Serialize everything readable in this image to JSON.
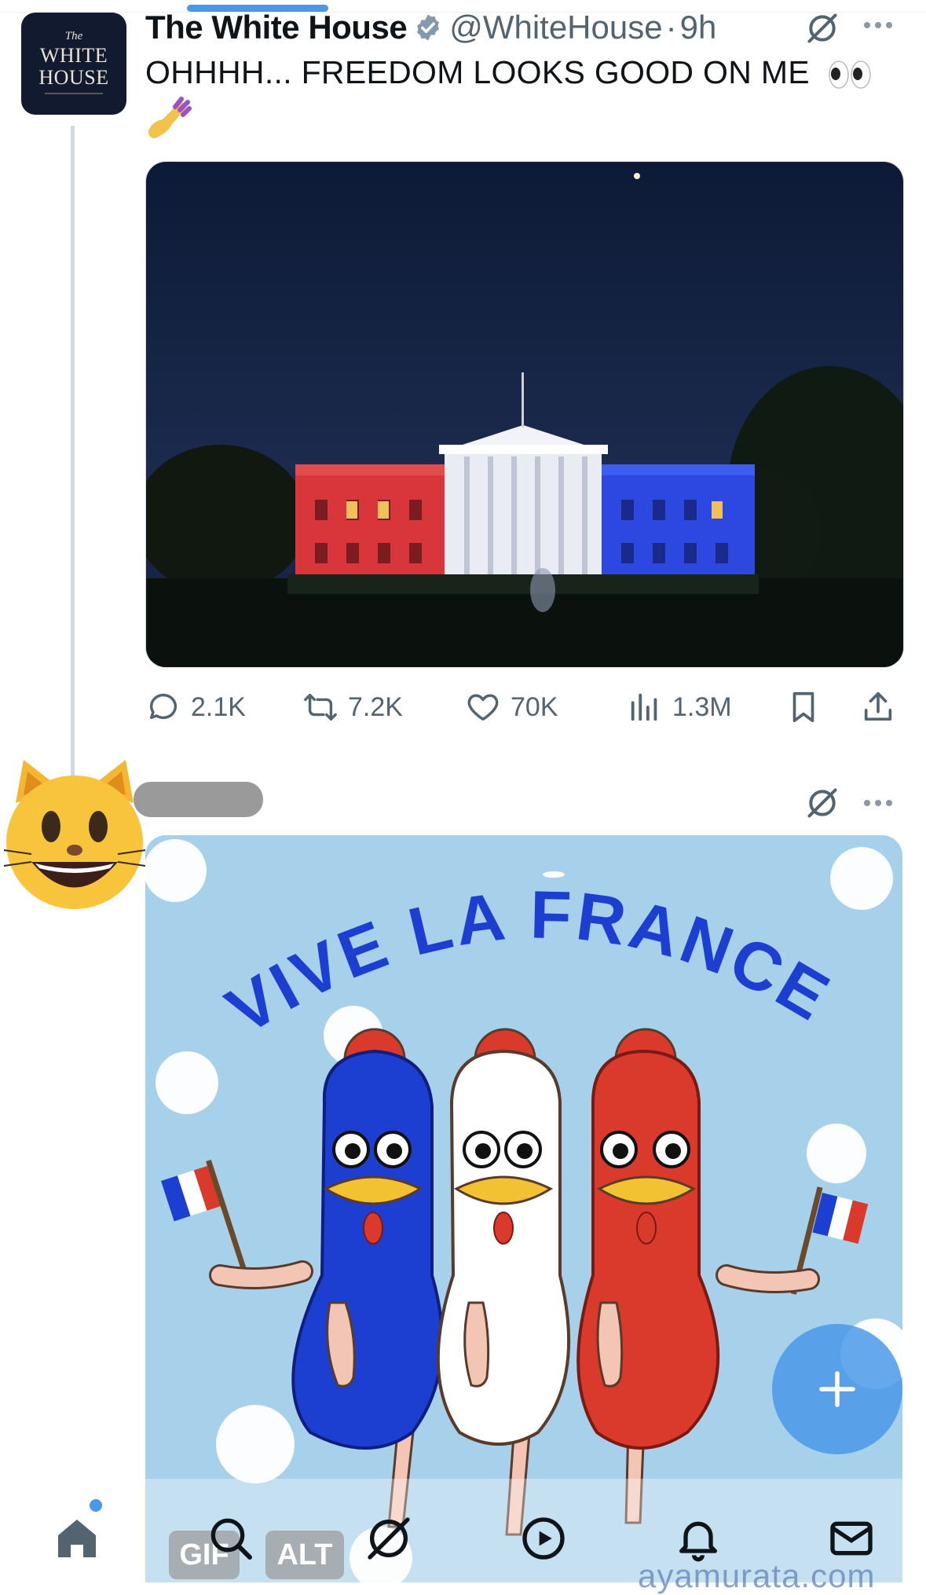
{
  "tweet": {
    "display_name": "The White House",
    "handle": "@WhiteHouse",
    "separator": "·",
    "time": "9h",
    "text": "OHHHH... FREEDOM LOOKS GOOD ON ME",
    "avatar_text": {
      "the": "The",
      "line1": "WHITE",
      "line2": "HOUSE"
    },
    "stats": {
      "replies": "2.1K",
      "reposts": "7.2K",
      "likes": "70K",
      "views": "1.3M"
    }
  },
  "reply": {
    "image_title": "VIVE LA FRANCE !",
    "badges": {
      "gif": "GIF",
      "alt": "ALT"
    },
    "watermark": "ayamurata.com"
  },
  "icons": {
    "verified": "verified-badge-icon",
    "grok": "grok-icon",
    "more": "more-icon",
    "reply": "reply-icon",
    "repost": "repost-icon",
    "like": "heart-icon",
    "views": "views-icon",
    "bookmark": "bookmark-icon",
    "share": "share-icon",
    "compose": "plus-icon",
    "nav": [
      "home-icon",
      "search-icon",
      "grok-icon",
      "video-icon",
      "bell-icon",
      "mail-icon"
    ]
  },
  "colors": {
    "accent": "#4a99e9",
    "muted": "#536471",
    "france_blue": "#1d3fd1",
    "france_red": "#d93a2b"
  }
}
